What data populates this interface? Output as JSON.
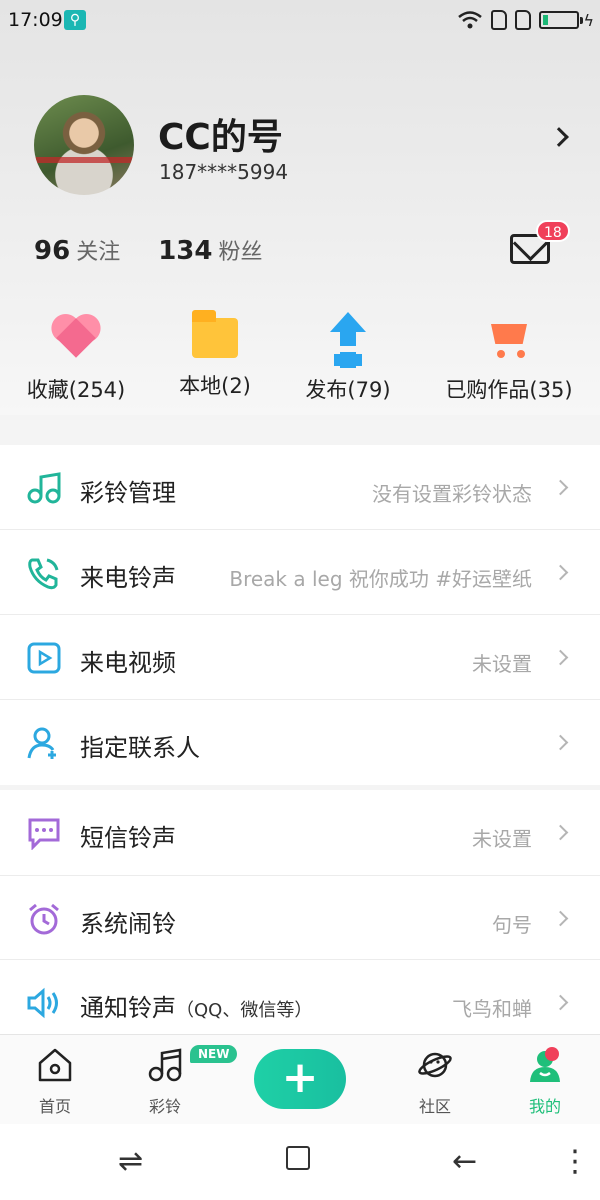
{
  "status_bar": {
    "time": "17:09",
    "usb_icon": "usb-icon",
    "icons": [
      "wifi-icon",
      "sim1-icon",
      "sim2-icon",
      "battery-charging-icon"
    ]
  },
  "profile": {
    "name": "CC的号",
    "phone": "187****5994",
    "stats": [
      {
        "num": "96",
        "label": "关注"
      },
      {
        "num": "134",
        "label": "粉丝"
      }
    ],
    "mail_badge": "18"
  },
  "quick_actions": [
    {
      "label": "收藏(254)",
      "icon": "heart-icon"
    },
    {
      "label": "本地(2)",
      "icon": "folder-icon"
    },
    {
      "label": "发布(79)",
      "icon": "upload-icon"
    },
    {
      "label": "已购作品(35)",
      "icon": "cart-icon"
    }
  ],
  "settings_group_1": [
    {
      "title": "彩铃管理",
      "value": "没有设置彩铃状态",
      "icon": "music-note-icon"
    },
    {
      "title": "来电铃声",
      "value": "Break a leg 祝你成功 #好运壁纸",
      "icon": "phone-ring-icon"
    },
    {
      "title": "来电视频",
      "value": "未设置",
      "icon": "video-play-icon"
    },
    {
      "title": "指定联系人",
      "value": "",
      "icon": "add-contact-icon"
    }
  ],
  "settings_group_2": [
    {
      "title": "短信铃声",
      "subtitle": "",
      "value": "未设置",
      "icon": "sms-icon"
    },
    {
      "title": "系统闹铃",
      "subtitle": "",
      "value": "句号",
      "icon": "alarm-clock-icon"
    },
    {
      "title": "通知铃声",
      "subtitle": "（QQ、微信等）",
      "value": "飞鸟和蝉",
      "icon": "speaker-icon"
    }
  ],
  "bottom_nav": {
    "items": [
      {
        "label": "首页",
        "icon": "home-icon"
      },
      {
        "label": "彩铃",
        "icon": "music-icon",
        "badge": "NEW"
      },
      {
        "label": "",
        "icon": "plus-icon"
      },
      {
        "label": "社区",
        "icon": "planet-icon"
      },
      {
        "label": "我的",
        "icon": "profile-icon",
        "active": true
      }
    ]
  },
  "system_nav": [
    "switch-apps-icon",
    "home-square-icon",
    "back-icon",
    "menu-dots-icon"
  ],
  "colors": {
    "accent": "#1fbf7a",
    "badge": "#f0405a",
    "teal_icon": "#21b59a",
    "blue_icon": "#2ca8e0",
    "purple_icon": "#a36ad8"
  }
}
